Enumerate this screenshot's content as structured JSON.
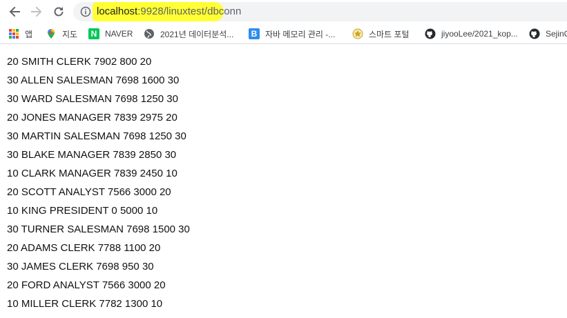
{
  "browser": {
    "url_host": "localhost",
    "url_path": ":9928/linuxtest/dbconn",
    "highlight_color": "#ffff33"
  },
  "bookmarks": [
    {
      "label": "앱",
      "icon": "apps-grid-icon"
    },
    {
      "label": "지도",
      "icon": "maps-pin-icon"
    },
    {
      "label": "NAVER",
      "icon": "naver-icon",
      "icon_text": "N"
    },
    {
      "label": "2021년 데이터분석...",
      "icon": "globe-icon"
    },
    {
      "label": "자바 메모리 관리 -...",
      "icon": "blog-b-icon",
      "icon_text": "B"
    },
    {
      "label": "스마트 포털",
      "icon": "portal-emblem-icon"
    },
    {
      "label": "jiyooLee/2021_kop...",
      "icon": "github-icon"
    },
    {
      "label": "SejinC",
      "icon": "github-icon"
    }
  ],
  "rows": [
    "20 SMITH CLERK 7902 800 20",
    "30 ALLEN SALESMAN 7698 1600 30",
    "30 WARD SALESMAN 7698 1250 30",
    "20 JONES MANAGER 7839 2975 20",
    "30 MARTIN SALESMAN 7698 1250 30",
    "30 BLAKE MANAGER 7839 2850 30",
    "10 CLARK MANAGER 7839 2450 10",
    "20 SCOTT ANALYST 7566 3000 20",
    "10 KING PRESIDENT 0 5000 10",
    "30 TURNER SALESMAN 7698 1500 30",
    "20 ADAMS CLERK 7788 1100 20",
    "30 JAMES CLERK 7698 950 30",
    "20 FORD ANALYST 7566 3000 20",
    "10 MILLER CLERK 7782 1300 10"
  ]
}
